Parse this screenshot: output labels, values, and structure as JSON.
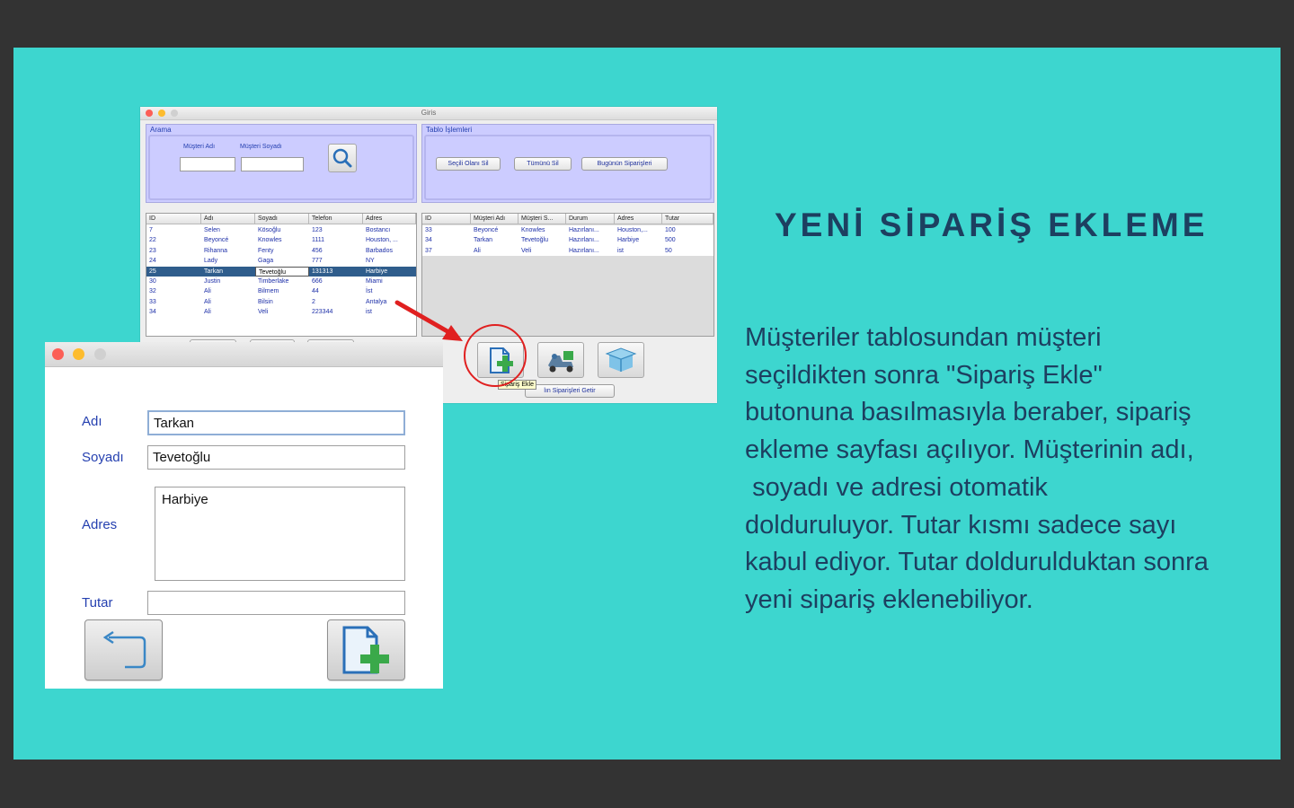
{
  "main_window": {
    "title": "Giris",
    "arama": {
      "title": "Arama",
      "musteri_adi_label": "Müşteri Adı",
      "musteri_soyadi_label": "Müşteri Soyadı"
    },
    "tablo_islemleri": {
      "title": "Tablo İşlemleri",
      "secili_sil": "Seçili Olanı Sil",
      "tumunu_sil": "Tümünü Sil",
      "bugunun_siparisleri": "Bugünün Siparişleri"
    },
    "customers_table": {
      "headers": [
        "ID",
        "Adı",
        "Soyadı",
        "Telefon",
        "Adres"
      ],
      "rows": [
        [
          "7",
          "Selen",
          "Kösoğlu",
          "123",
          "Bostancı"
        ],
        [
          "22",
          "Beyoncé",
          "Knowles",
          "1111",
          "Houston, ..."
        ],
        [
          "23",
          "Rihanna",
          "Fenty",
          "456",
          "Barbados"
        ],
        [
          "24",
          "Lady",
          "Gaga",
          "777",
          "NY"
        ],
        [
          "25",
          "Tarkan",
          "Tevetoğlu",
          "131313",
          "Harbiye"
        ],
        [
          "30",
          "Justin",
          "Timberlake",
          "666",
          "Miami"
        ],
        [
          "32",
          "Ali",
          "Bilmem",
          "44",
          "İst"
        ],
        [
          "33",
          "Ali",
          "Bilsin",
          "2",
          "Antalya"
        ],
        [
          "34",
          "Ali",
          "Veli",
          "223344",
          "ist"
        ]
      ],
      "selected_index": 4
    },
    "orders_table": {
      "headers": [
        "ID",
        "Müşteri Adı",
        "Müşteri S...",
        "Durum",
        "Adres",
        "Tutar"
      ],
      "rows": [
        [
          "33",
          "Beyoncé",
          "Knowles",
          "Hazırlanı...",
          "Houston,...",
          "100"
        ],
        [
          "34",
          "Tarkan",
          "Tevetoğlu",
          "Hazırlanı...",
          "Harbiye",
          "500"
        ],
        [
          "37",
          "Ali",
          "Veli",
          "Hazırlanı...",
          "ist",
          "50"
        ]
      ]
    },
    "tooltip": "Sipariş Ekle",
    "yolda_button_partial": "lın Siparişleri Getir"
  },
  "order_form": {
    "adi_label": "Adı",
    "adi_value": "Tarkan",
    "soyadi_label": "Soyadı",
    "soyadi_value": "Tevetoğlu",
    "adres_label": "Adres",
    "adres_value": "Harbiye",
    "tutar_label": "Tutar",
    "tutar_value": ""
  },
  "slide": {
    "heading": "YENİ SİPARİŞ EKLEME",
    "body": "Müşteriler tablosundan müşteri\nseçildikten sonra \"Sipariş Ekle\"\nbutonuna basılmasıyla beraber, sipariş\nekleme sayfası açılıyor. Müşterinin adı,\n soyadı ve adresi otomatik\ndolduruluyor. Tutar kısmı sadece sayı\nkabul ediyor. Tutar doldurulduktan sonra\nyeni sipariş eklenebiliyor."
  },
  "colors": {
    "frame": "#333333",
    "slide_bg": "#3dd6cf",
    "text": "#1d3f60",
    "panel": "#ccccff",
    "selection": "#2f5d8c",
    "highlight": "#e02020"
  },
  "icons": [
    "search-icon",
    "add-order-icon",
    "delivery-scooter-icon",
    "box-icon",
    "back-arrow-icon",
    "red-arrow-icon"
  ]
}
